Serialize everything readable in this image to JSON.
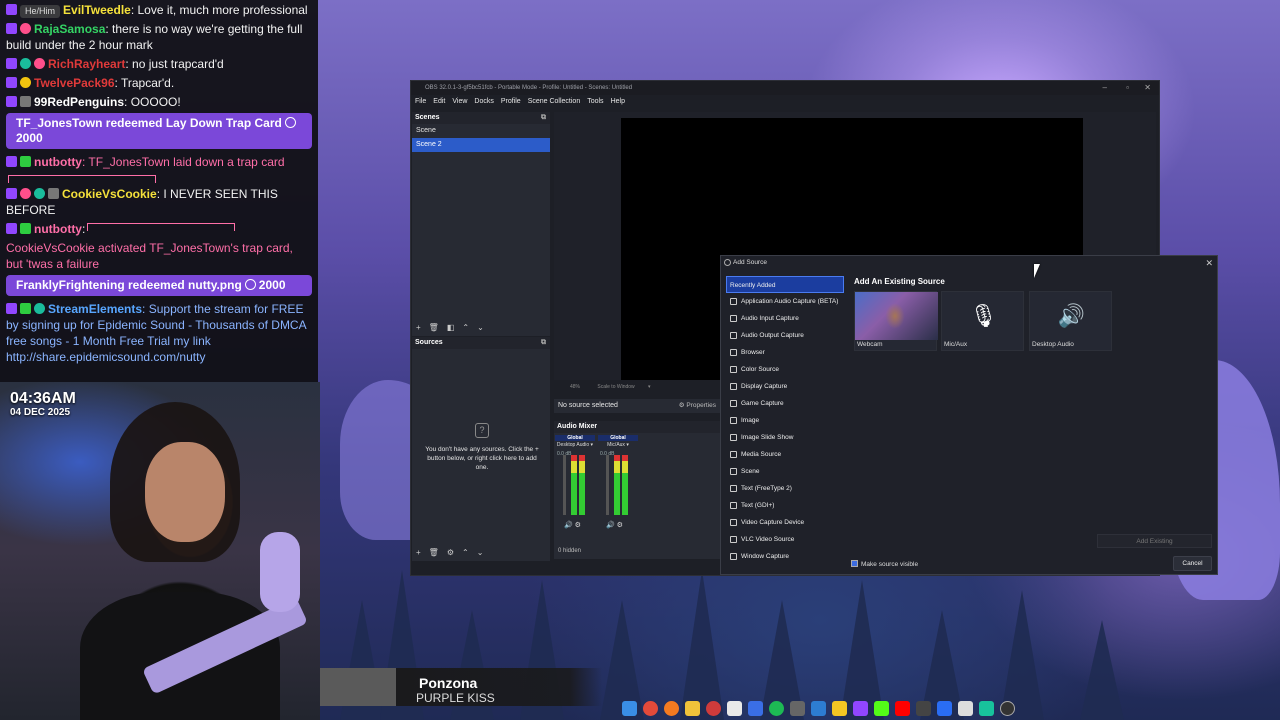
{
  "chat": {
    "messages": [
      {
        "pronoun": "He/Him",
        "user": "EvilTweedle",
        "user_color": "#f5e13b",
        "text": ": Love it, much more professional"
      },
      {
        "user": "RajaSamosa",
        "user_color": "#34d364",
        "text": ": there is no way we're getting the full build under the 2 hour mark"
      },
      {
        "user": "RichRayheart",
        "user_color": "#e03a3a",
        "text": ": no just trapcard'd"
      },
      {
        "user": "TwelvePack96",
        "user_color": "#e03a3a",
        "text": ": Trapcar'd."
      },
      {
        "user": "99RedPenguins",
        "user_color": "#ffffff",
        "text": ": OOOOO!"
      }
    ],
    "redeem1": "TF_JonesTown redeemed Lay Down Trap Card",
    "redeem1_cost": "2000",
    "bot1_user": "nutbotty",
    "bot1_text": ": TF_JonesTown laid down a trap card",
    "cookie_user": "CookieVsCookie",
    "cookie_text": ": I NEVER SEEN THIS BEFORE",
    "bot2_user": "nutbotty",
    "bot2_text": ":",
    "trap_text": "CookieVsCookie activated TF_JonesTown's trap card, but 'twas a failure",
    "redeem2": "FranklyFrightening redeemed nutty.png",
    "redeem2_cost": "2000",
    "se_user": "StreamElements",
    "se_text": ": Support the stream for FREE by signing up for Epidemic Sound - Thousands of DMCA free songs - 1 Month Free Trial my link http://share.epidemicsound.com/nutty"
  },
  "webcam": {
    "time": "04:36AM",
    "date": "04 DEC 2025"
  },
  "now_playing": {
    "song": "Ponzona",
    "artist": "PURPLE KISS"
  },
  "obs": {
    "title": "OBS 32.0.1-3-gf5bc51fcb - Portable Mode - Profile: Untitled - Scenes: Untitled",
    "menu": [
      "File",
      "Edit",
      "View",
      "Docks",
      "Profile",
      "Scene Collection",
      "Tools",
      "Help"
    ],
    "scenes_title": "Scenes",
    "scenes": [
      "Scene",
      "Scene 2"
    ],
    "sources_title": "Sources",
    "sources_empty": "You don't have any sources. Click the + button below, or right click here to add one.",
    "zoom": "48%",
    "scale_mode": "Scale to Window",
    "no_source": "No source selected",
    "properties": "Properties",
    "mixer_title": "Audio Mixer",
    "mixer_channels": [
      {
        "global": "Global",
        "name": "Desktop Audio",
        "db": "0.0 dB"
      },
      {
        "global": "Global",
        "name": "Mic/Aux",
        "db": "0.0 dB"
      }
    ],
    "hidden": "0 hidden"
  },
  "dialog": {
    "title": "Add Source",
    "source_types": [
      "Recently Added",
      "Application Audio Capture (BETA)",
      "Audio Input Capture",
      "Audio Output Capture",
      "Browser",
      "Color Source",
      "Display Capture",
      "Game Capture",
      "Image",
      "Image Slide Show",
      "Media Source",
      "Scene",
      "Text (FreeType 2)",
      "Text (GDI+)",
      "Video Capture Device",
      "VLC Video Source",
      "Window Capture"
    ],
    "existing_title": "Add An Existing Source",
    "existing": [
      {
        "label": "Webcam",
        "icon": "camera-thumbnail"
      },
      {
        "label": "Mic/Aux",
        "icon": "microphone-icon"
      },
      {
        "label": "Desktop Audio",
        "icon": "speaker-icon"
      }
    ],
    "add_existing": "Add Existing",
    "make_visible": "Make source visible",
    "cancel": "Cancel"
  }
}
